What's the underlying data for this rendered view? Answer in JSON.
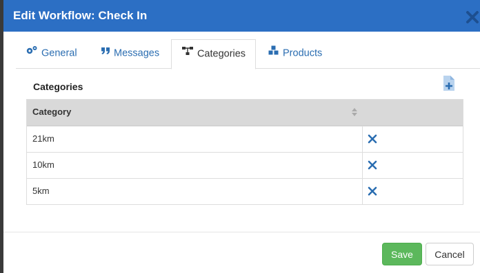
{
  "dialog": {
    "title": "Edit Workflow: Check In",
    "close_icon": "close-icon"
  },
  "tabs": [
    {
      "label": "General",
      "icon": "gears-icon",
      "active": false
    },
    {
      "label": "Messages",
      "icon": "quote-icon",
      "active": false
    },
    {
      "label": "Categories",
      "icon": "sitemap-icon",
      "active": true
    },
    {
      "label": "Products",
      "icon": "cubes-icon",
      "active": false
    }
  ],
  "section": {
    "title": "Categories",
    "add_icon": "add-file-icon"
  },
  "table": {
    "header": "Category",
    "rows": [
      {
        "name": "21km"
      },
      {
        "name": "10km"
      },
      {
        "name": "5km"
      }
    ]
  },
  "footer": {
    "save_label": "Save",
    "cancel_label": "Cancel"
  },
  "colors": {
    "header_bg": "#2c6fc4",
    "link": "#2a6db1",
    "save_bg": "#5cb85c",
    "delete_icon": "#2a6db1"
  }
}
